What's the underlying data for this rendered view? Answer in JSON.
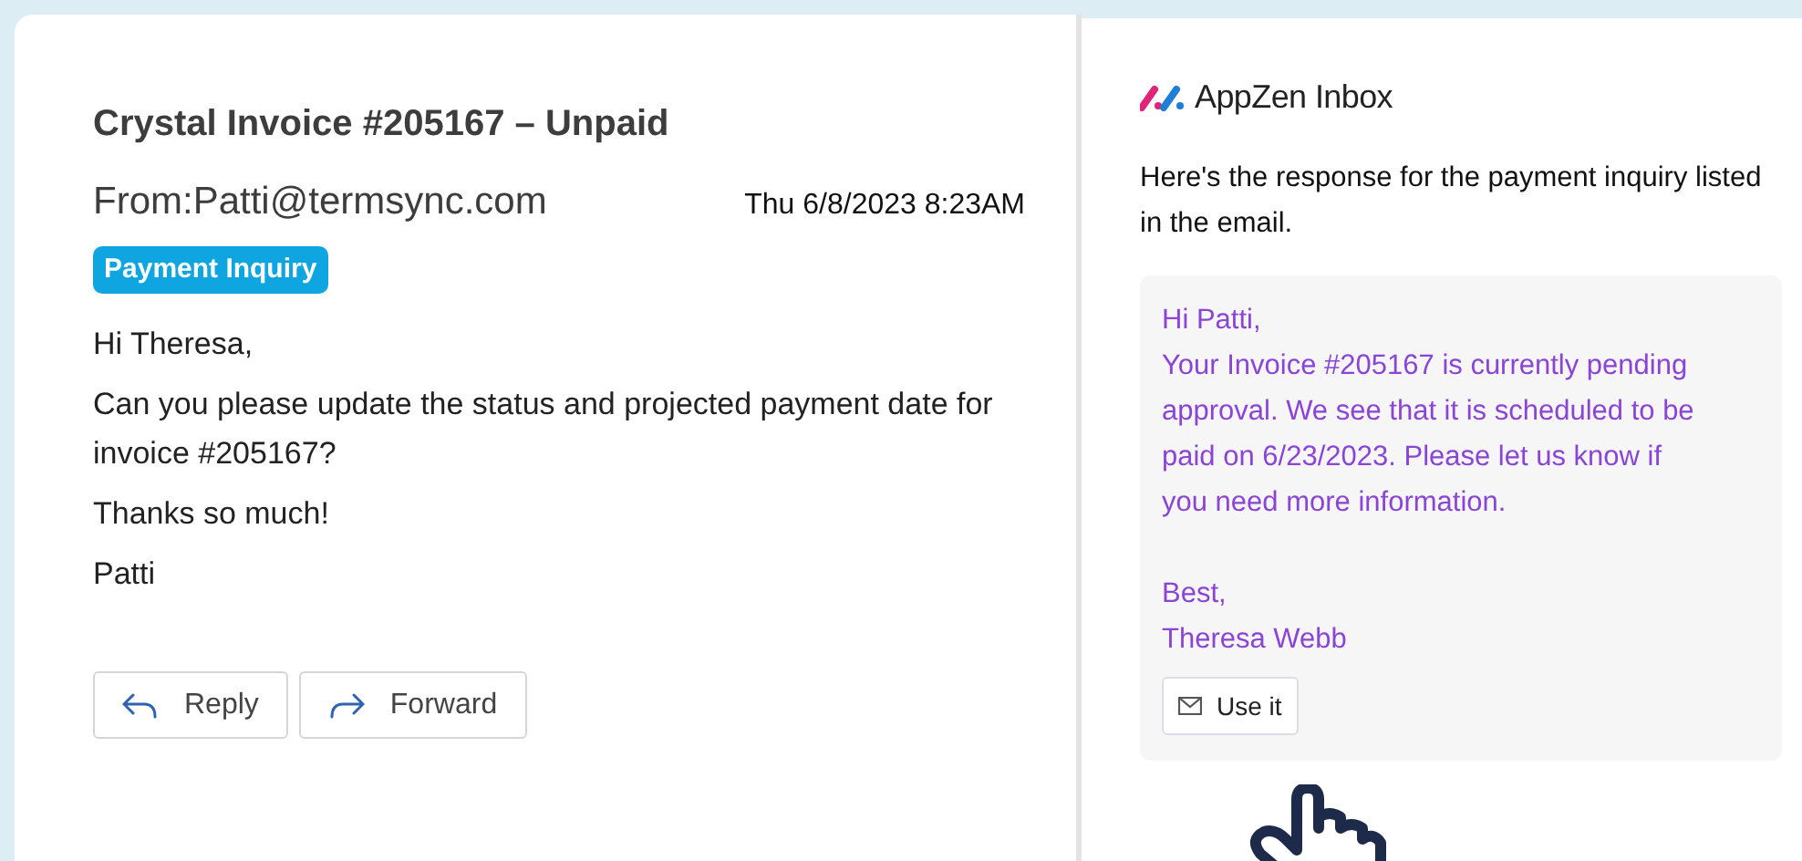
{
  "email": {
    "subject": "Crystal Invoice #205167 – Unpaid",
    "from": "From:Patti@termsync.com",
    "date": "Thu 6/8/2023 8:23AM",
    "tag": "Payment Inquiry",
    "body": [
      "Hi Theresa,",
      "Can you please update the status and projected payment date for invoice #205167?",
      "Thanks so much!",
      "Patti"
    ],
    "buttons": [
      {
        "label": "Reply",
        "kind": "reply"
      },
      {
        "label": "Forward",
        "kind": "forward"
      }
    ]
  },
  "assistant": {
    "brand": "AppZen Inbox",
    "intro": "Here's the response for the payment inquiry listed in the email.",
    "response": [
      "Hi Patti,",
      "Your Invoice #205167 is currently pending approval. We see that it is scheduled to be paid on 6/23/2023. Please let us know if you need more information."
    ],
    "signoff": [
      "Best,",
      "Theresa Webb"
    ],
    "button": "Use it"
  }
}
